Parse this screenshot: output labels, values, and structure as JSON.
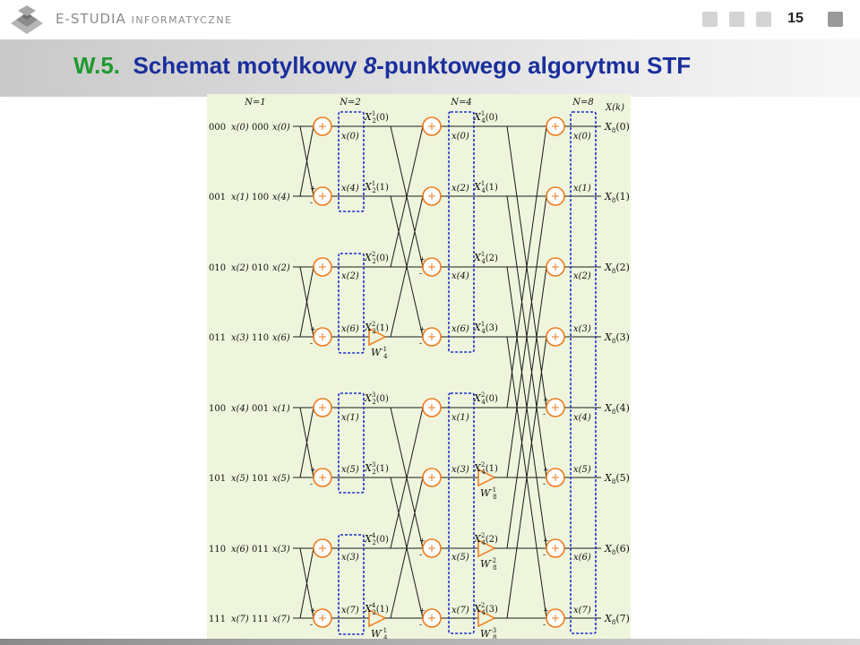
{
  "header": {
    "brand_main": "E-STUDIA",
    "brand_sub": "INFORMATYCZNE",
    "page_number": "15",
    "logo_icon": "e-studia-logo-icon"
  },
  "slide": {
    "title_number": "W.5.",
    "title_text_before": "Schemat motylkowy",
    "title_italic": "8",
    "title_text_after": "-punktowego algorytmu STF"
  },
  "diagram": {
    "stage_labels": [
      "N=1",
      "N=2",
      "N=4",
      "N=8"
    ],
    "output_header": "X(k)",
    "binary_in": [
      "000",
      "001",
      "010",
      "011",
      "100",
      "101",
      "110",
      "111"
    ],
    "input_labels": [
      "x(0)",
      "x(1)",
      "x(2)",
      "x(3)",
      "x(4)",
      "x(5)",
      "x(6)",
      "x(7)"
    ],
    "reversed_binary": [
      "000",
      "100",
      "010",
      "110",
      "001",
      "101",
      "011",
      "111"
    ],
    "reordered_labels": [
      "x(0)",
      "x(4)",
      "x(2)",
      "x(6)",
      "x(1)",
      "x(5)",
      "x(3)",
      "x(7)"
    ],
    "box2_labels": [
      "x(0)",
      "x(4)",
      "x(2)",
      "x(6)",
      "x(1)",
      "x(5)",
      "x(3)",
      "x(7)"
    ],
    "box4_labels": [
      "x(0)",
      "x(2)",
      "x(4)",
      "x(6)",
      "x(1)",
      "x(3)",
      "x(5)",
      "x(7)"
    ],
    "box8_labels": [
      "x(0)",
      "x(1)",
      "x(2)",
      "x(3)",
      "x(4)",
      "x(5)",
      "x(6)",
      "x(7)"
    ],
    "x2_labels": [
      {
        "sup": "1",
        "arg": "(0)"
      },
      {
        "sup": "1",
        "arg": "(1)"
      },
      {
        "sup": "2",
        "arg": "(0)"
      },
      {
        "sup": "2",
        "arg": "(1)"
      },
      {
        "sup": "3",
        "arg": "(0)"
      },
      {
        "sup": "3",
        "arg": "(1)"
      },
      {
        "sup": "4",
        "arg": "(0)"
      },
      {
        "sup": "4",
        "arg": "(1)"
      }
    ],
    "x4_labels": [
      {
        "sup": "1",
        "arg": "(0)"
      },
      {
        "sup": "1",
        "arg": "(1)"
      },
      {
        "sup": "1",
        "arg": "(2)"
      },
      {
        "sup": "1",
        "arg": "(3)"
      },
      {
        "sup": "2",
        "arg": "(0)"
      },
      {
        "sup": "2",
        "arg": "(1)"
      },
      {
        "sup": "2",
        "arg": "(2)"
      },
      {
        "sup": "2",
        "arg": "(3)"
      }
    ],
    "output_labels": [
      "(0)",
      "(1)",
      "(2)",
      "(3)",
      "(4)",
      "(5)",
      "(6)",
      "(7)"
    ],
    "twiddles_stage2": [
      {
        "base": "W",
        "sub": "4",
        "sup": "-1"
      }
    ],
    "twiddles_stage3": [
      {
        "base": "W",
        "sub": "8",
        "sup": "-1"
      },
      {
        "base": "W",
        "sub": "8",
        "sup": "-2"
      },
      {
        "base": "W",
        "sub": "8",
        "sup": "-3"
      }
    ],
    "colors": {
      "background": "#eef5dc",
      "node": "#f07a1a",
      "box": "#1c2fd0",
      "line": "#1a1a1a"
    }
  }
}
